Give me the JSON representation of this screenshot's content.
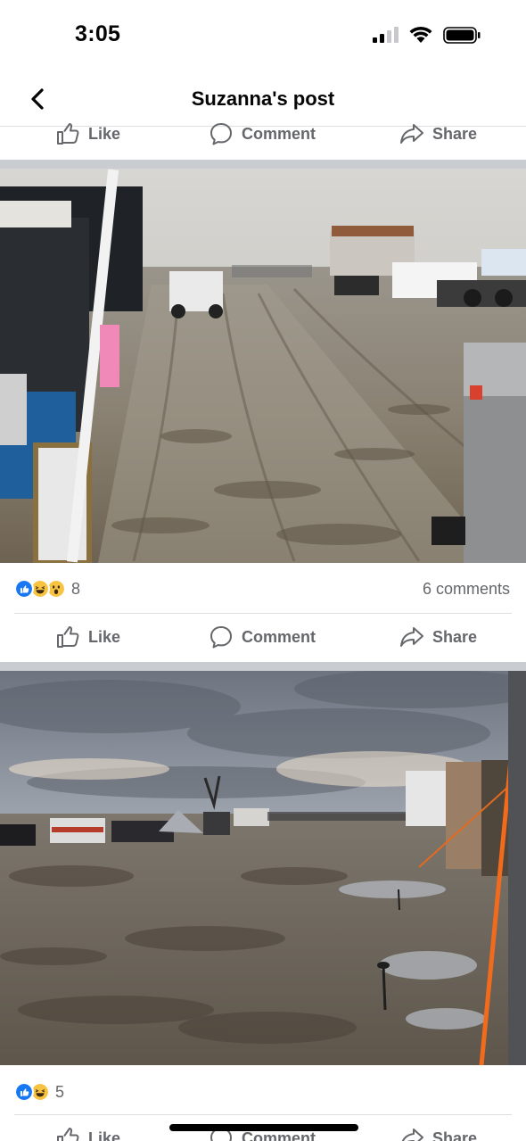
{
  "status": {
    "time": "3:05"
  },
  "header": {
    "title": "Suzanna's post"
  },
  "actions": {
    "like": "Like",
    "comment": "Comment",
    "share": "Share"
  },
  "post1": {
    "reaction_count": "8",
    "comments": "6 comments"
  },
  "post2": {
    "reaction_count": "5"
  },
  "colors": {
    "accent": "#1877f2",
    "action_text": "#65676b",
    "divider": "#c9ccd1"
  },
  "icons": [
    "back-chevron-icon",
    "signal-icon",
    "wifi-icon",
    "battery-icon",
    "like-icon",
    "comment-icon",
    "share-icon",
    "like-reaction-icon",
    "haha-reaction-icon",
    "wow-reaction-icon"
  ]
}
